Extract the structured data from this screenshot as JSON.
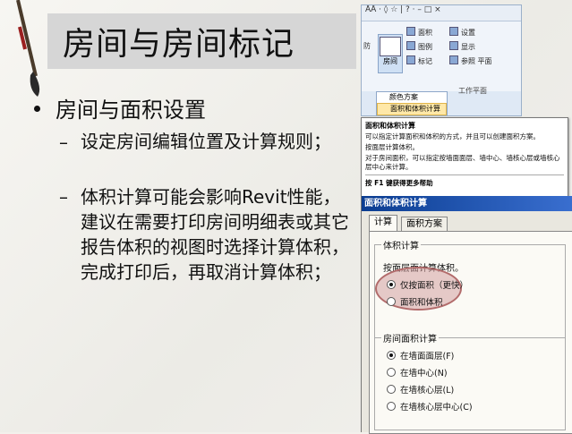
{
  "slide": {
    "title": "房间与房间标记",
    "bullet": "房间与面积设置",
    "sub_items": [
      {
        "dash": "–",
        "text": "设定房间编辑位置及计算规则；"
      },
      {
        "dash": "–",
        "text": "体积计算可能会影响Revit性能，建议在需要打印房间明细表或其它报告体积的视图时选择计算体积，完成打印后，再取消计算体积；"
      }
    ]
  },
  "ribbon": {
    "top_icons": "ÅÅ · ◊ ☆ | ? ·  –  □  ×",
    "side_left": "防",
    "big_button": "房间",
    "items": [
      "面积",
      "图例",
      "标记",
      "设置",
      "显示",
      "参照",
      "平面"
    ],
    "panel_caption": "工作平面",
    "dropdown": [
      "颜色方案",
      "面积和体积计算"
    ]
  },
  "tooltip": {
    "title": "面积和体积计算",
    "lines": [
      "可以指定计算面积和体积的方式，并且可以创建面积方案。",
      "按面层计算体积。",
      "对于房间面积，可以指定按墙面面层、墙中心、墙核心层或墙核心层中心来计算。"
    ],
    "footer": "按 F1 键获得更多帮助"
  },
  "dialog": {
    "title": "面积和体积计算",
    "tabs": [
      "计算",
      "面积方案"
    ],
    "volume_group_label": "体积计算",
    "volume_desc": "按面层面计算体积。",
    "volume_options": [
      {
        "label": "仅按面积（更快）",
        "selected": true
      },
      {
        "label": "面积和体积",
        "selected": false
      }
    ],
    "area_group_label": "房间面积计算",
    "area_options": [
      {
        "label": "在墙面面层(F)",
        "selected": true
      },
      {
        "label": "在墙中心(N)",
        "selected": false
      },
      {
        "label": "在墙核心层(L)",
        "selected": false
      },
      {
        "label": "在墙核心层中心(C)",
        "selected": false
      }
    ]
  },
  "colors": {
    "title_bar": "#d6d6d6",
    "dialog_title": "#0b3d91",
    "highlight": "#d4a0a0"
  }
}
